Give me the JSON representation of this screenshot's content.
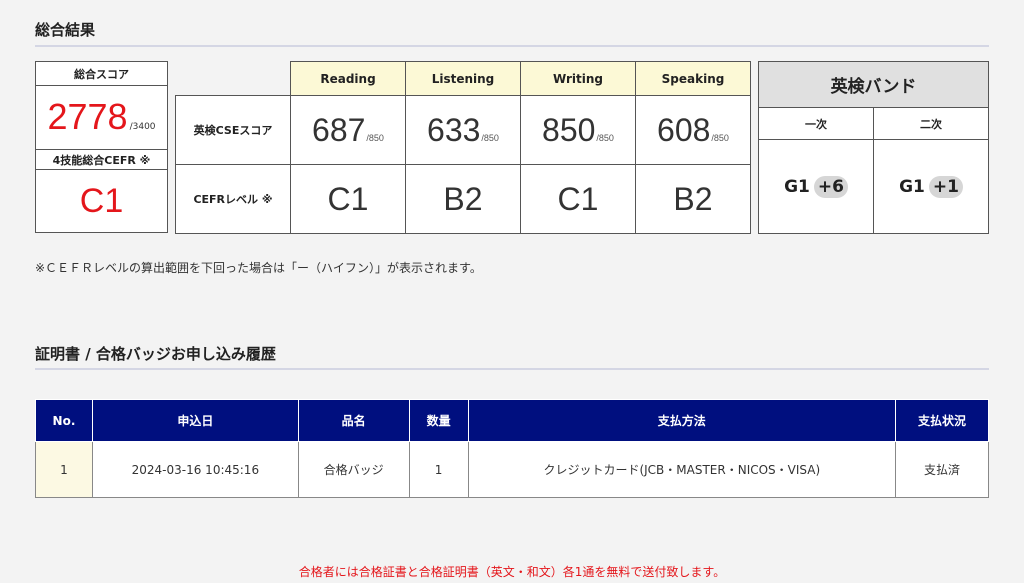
{
  "results": {
    "title": "総合結果",
    "total_score_label": "総合スコア",
    "total_score": "2778",
    "total_score_max": "/3400",
    "cefr_total_label": "4技能総合CEFR ※",
    "cefr_total": "C1",
    "cse_row_label": "英検CSEスコア",
    "cefr_row_label": "CEFRレベル ※",
    "skills": [
      {
        "name": "Reading",
        "score": "687",
        "max": "/850",
        "cefr": "C1"
      },
      {
        "name": "Listening",
        "score": "633",
        "max": "/850",
        "cefr": "B2"
      },
      {
        "name": "Writing",
        "score": "850",
        "max": "/850",
        "cefr": "C1"
      },
      {
        "name": "Speaking",
        "score": "608",
        "max": "/850",
        "cefr": "B2"
      }
    ],
    "band": {
      "title": "英検バンド",
      "first_label": "一次",
      "second_label": "二次",
      "first_grade": "G1",
      "first_value": "+6",
      "second_grade": "G1",
      "second_value": "+1"
    },
    "note": "※ＣＥＦＲレベルの算出範囲を下回った場合は「ー（ハイフン）」が表示されます。"
  },
  "history": {
    "title": "証明書 / 合格バッジお申し込み履歴",
    "headers": [
      "No.",
      "申込日",
      "品名",
      "数量",
      "支払方法",
      "支払状況"
    ],
    "rows": [
      [
        "1",
        "2024-03-16 10:45:16",
        "合格バッジ",
        "1",
        "クレジットカード(JCB・MASTER・NICOS・VISA)",
        "支払済"
      ]
    ]
  },
  "footer": "合格者には合格証書と合格証明書（英文・和文）各1通を無料で送付致します。",
  "colors": {
    "accent_red": "#e4161b",
    "header_navy": "#000f7f",
    "skill_header_bg": "#fcf9d6"
  }
}
